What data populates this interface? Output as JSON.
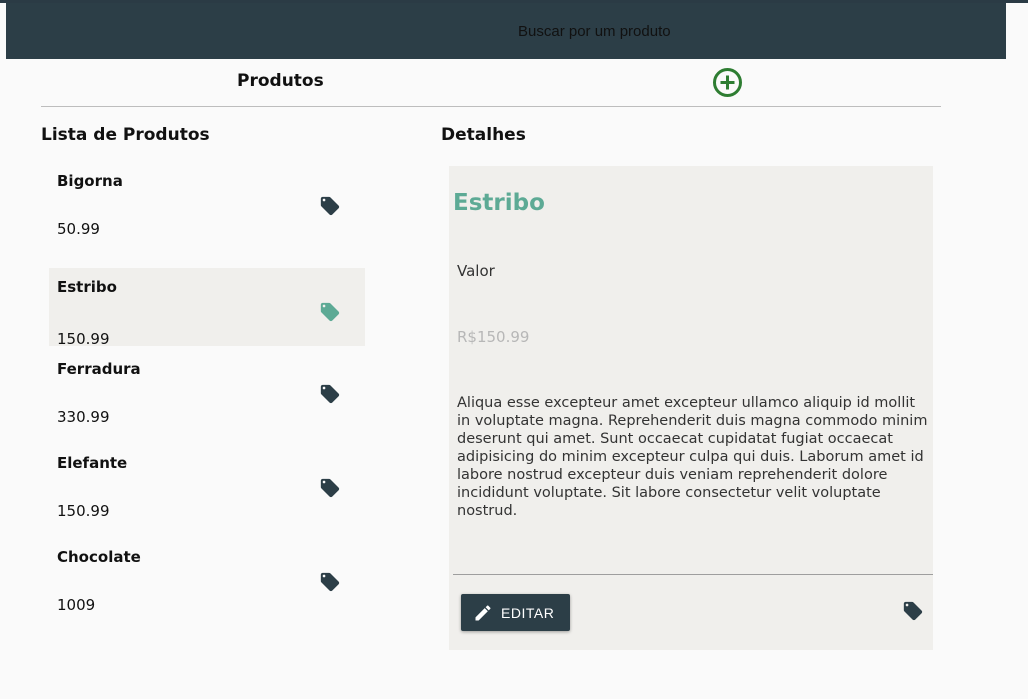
{
  "search": {
    "placeholder": "Buscar por um produto"
  },
  "header": {
    "title": "Produtos",
    "add_icon": "add-circle-icon"
  },
  "list": {
    "title": "Lista de Produtos",
    "items": [
      {
        "name": "Bigorna",
        "price": "50.99",
        "selected": false
      },
      {
        "name": "Estribo",
        "price": "150.99",
        "selected": true
      },
      {
        "name": "Ferradura",
        "price": "330.99",
        "selected": false
      },
      {
        "name": "Elefante",
        "price": "150.99",
        "selected": false
      },
      {
        "name": "Chocolate",
        "price": "1009",
        "selected": false
      }
    ]
  },
  "details": {
    "title": "Detalhes",
    "name": "Estribo",
    "value_label": "Valor",
    "price": "R$150.99",
    "description": "Aliqua esse excepteur amet excepteur ullamco aliquip id mollit in voluptate magna. Reprehenderit duis magna commodo minim deserunt qui amet. Sunt occaecat cupidatat fugiat occaecat adipisicing do minim excepteur culpa qui duis. Laborum amet id labore nostrud excepteur duis veniam reprehenderit dolore incididunt voluptate. Sit labore consectetur velit voluptate nostrud.",
    "edit_label": "EDITAR"
  },
  "colors": {
    "topbar": "#2c3e47",
    "accent": "#5daa95",
    "add_icon": "#2e7d32",
    "tag": "#2c3e47",
    "tag_selected": "#5daa95",
    "selected_bg": "#f0efec"
  }
}
